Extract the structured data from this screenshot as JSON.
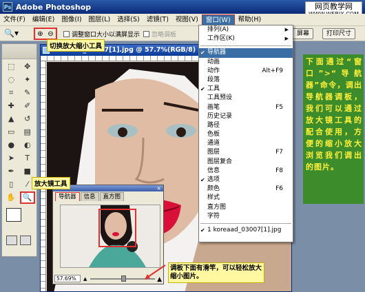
{
  "app": {
    "title": "Adobe Photoshop",
    "logo": "Ps"
  },
  "watermark": {
    "line1": "网页教学网",
    "line2": "WWW.WEBJX.COM"
  },
  "menubar": [
    "文件(F)",
    "编辑(E)",
    "图像(I)",
    "图层(L)",
    "选择(S)",
    "滤镜(T)",
    "视图(V)",
    "窗口(W)",
    "帮助(H)"
  ],
  "options": {
    "cb1": "调整窗口大小以满屏显示",
    "cb2": "忽略调板",
    "btn_print": "打印尺寸",
    "btn_screen": "屏幕"
  },
  "document": {
    "title": "koreaad_03007[1].jpg @ 57.7%(RGB/8)"
  },
  "window_menu": {
    "items": [
      {
        "label": "排列(A)",
        "shortcut": "",
        "submenu": true,
        "check": false
      },
      {
        "label": "工作区(K)",
        "shortcut": "",
        "submenu": true,
        "check": false
      },
      {
        "sep": true
      },
      {
        "label": "导航器",
        "shortcut": "",
        "check": true,
        "highlight": true
      },
      {
        "label": "动画",
        "shortcut": ""
      },
      {
        "label": "动作",
        "shortcut": "Alt+F9"
      },
      {
        "label": "段落",
        "shortcut": ""
      },
      {
        "label": "工具",
        "shortcut": "",
        "check": true
      },
      {
        "label": "工具预设",
        "shortcut": ""
      },
      {
        "label": "画笔",
        "shortcut": "F5"
      },
      {
        "label": "历史记录",
        "shortcut": ""
      },
      {
        "label": "路径",
        "shortcut": ""
      },
      {
        "label": "色板",
        "shortcut": ""
      },
      {
        "label": "通道",
        "shortcut": ""
      },
      {
        "label": "图层",
        "shortcut": "F7"
      },
      {
        "label": "图层复合",
        "shortcut": ""
      },
      {
        "label": "信息",
        "shortcut": "F8"
      },
      {
        "label": "选项",
        "shortcut": "",
        "check": true
      },
      {
        "label": "颜色",
        "shortcut": "F6"
      },
      {
        "label": "样式",
        "shortcut": ""
      },
      {
        "label": "直方图",
        "shortcut": ""
      },
      {
        "label": "字符",
        "shortcut": ""
      },
      {
        "sep": true
      },
      {
        "label": "1 koreaad_03007[1].jpg",
        "shortcut": "",
        "check": true
      }
    ]
  },
  "navigator": {
    "tabs": [
      "导航器",
      "信息",
      "直方图"
    ],
    "zoom": "57.69%",
    "zoom_level_fraction": 0.52
  },
  "callouts": {
    "zoom_switch": "切换放大缩小工具",
    "zoom_tool": "放大镜工具",
    "slider_note": "调板下面有滑竿，可以轻松放大缩小图片。"
  },
  "instruction": "下面通过“窗口”>“导航器”命令，调出导航器调板，我们可以通过放大镜工具的配合使用，方便的缩小放大浏览我们调出的图片。",
  "colors": {
    "accent_red": "#e03030",
    "menu_highlight": "#3a6ea5",
    "note_bg": "#3c8c2c",
    "note_text": "#fff03a"
  }
}
